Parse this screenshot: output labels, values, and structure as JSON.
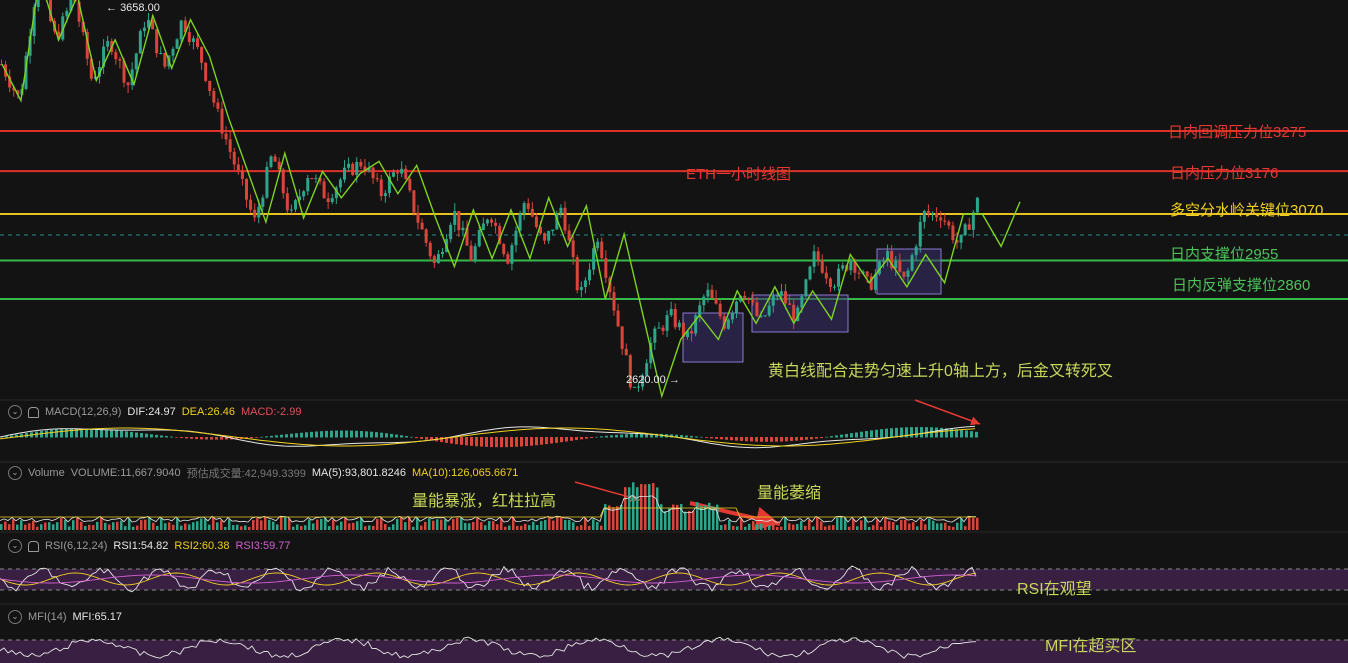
{
  "chart_data": {
    "type": "line",
    "title": "ETH一小时线图",
    "price_marks": {
      "high": "3658.00",
      "low": "2620.00"
    },
    "levels": [
      {
        "label": "日内回调压力位3275",
        "value": 3275,
        "color": "#e0302a"
      },
      {
        "label": "日内压力位3176",
        "value": 3176,
        "color": "#e0302a"
      },
      {
        "label": "多空分水岭关键位3070",
        "value": 3070,
        "color": "#e8c020"
      },
      {
        "label": "日内支撑位2955",
        "value": 2955,
        "color": "#35b84a"
      },
      {
        "label": "日内反弹支撑位2860",
        "value": 2860,
        "color": "#35b84a"
      }
    ],
    "zigzag": [
      3440,
      3350,
      3655,
      3500,
      3610,
      3400,
      3500,
      3390,
      3560,
      3430,
      3550,
      3460,
      3310,
      3180,
      3050,
      3220,
      3060,
      3175,
      3110,
      3170,
      3200,
      3120,
      3190,
      3060,
      2940,
      3080,
      2960,
      3080,
      2960,
      3110,
      2990,
      3090,
      2860,
      3020,
      2820,
      2620,
      2760,
      2820,
      2760,
      2880,
      2800,
      2890,
      2800,
      2880,
      2810,
      2970,
      2900,
      2960,
      2890,
      2970,
      2900,
      3070,
      3070,
      2990,
      3100
    ],
    "rsi_band": [
      30,
      70
    ],
    "mfi_band": [
      20,
      80
    ]
  },
  "annotations": {
    "title": "ETH一小时线图",
    "macd_note": "黄白线配合走势匀速上升0轴上方，后金叉转死叉",
    "vol_note1": "量能暴涨，红柱拉高",
    "vol_note2": "量能萎缩",
    "rsi_note": "RSI在观望",
    "mfi_note": "MFI在超买区"
  },
  "macd": {
    "name": "MACD(12,26,9)",
    "dif": "DIF:24.97",
    "dea": "DEA:26.46",
    "macd": "MACD:-2.99"
  },
  "volume": {
    "name": "Volume",
    "vol": "VOLUME:11,667.9040",
    "est": "预估成交量:42,949.3399",
    "ma5": "MA(5):93,801.8246",
    "ma10": "MA(10):126,065.6671"
  },
  "rsi": {
    "name": "RSI(6,12,24)",
    "r1": "RSI1:54.82",
    "r2": "RSI2:60.38",
    "r3": "RSI3:59.77"
  },
  "mfi": {
    "name": "MFI(14)",
    "v": "MFI:65.17"
  },
  "colors": {
    "up": "#2ea58a",
    "down": "#d9453a",
    "zigzag": "#7ed321",
    "box": "#4a3a8a"
  }
}
